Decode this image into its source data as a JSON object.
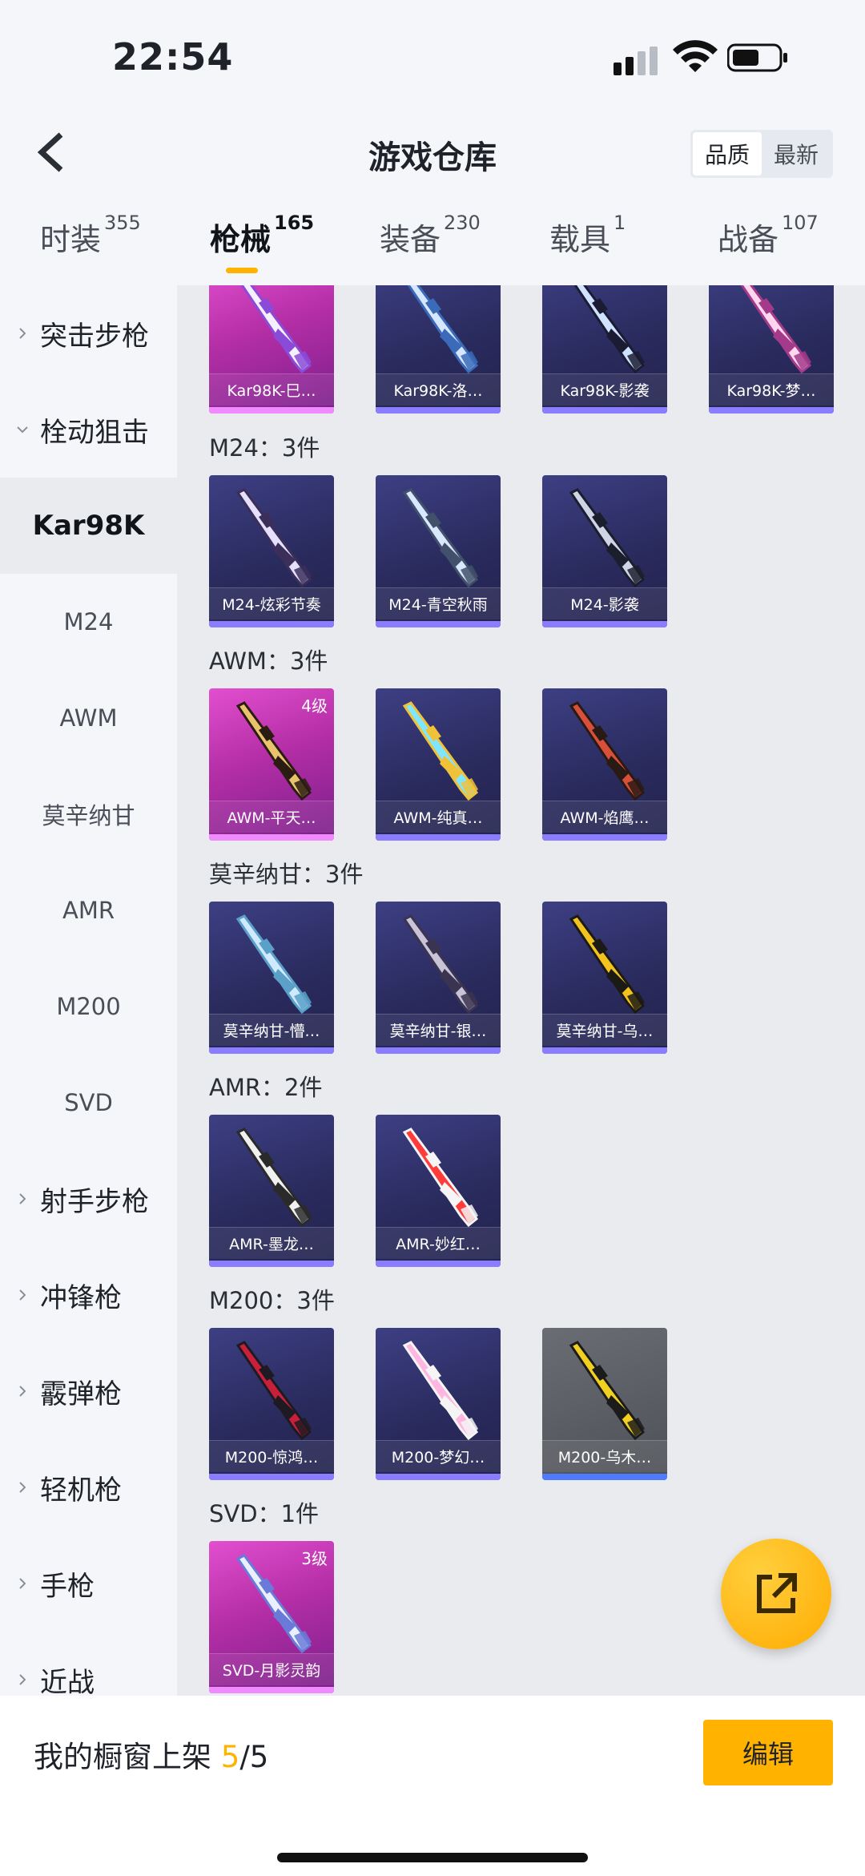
{
  "status_bar": {
    "time": "22:54"
  },
  "header": {
    "title": "游戏仓库",
    "sort_options": [
      "品质",
      "最新"
    ],
    "active_sort": "品质"
  },
  "tabs": [
    {
      "label": "时装",
      "count": "355"
    },
    {
      "label": "枪械",
      "count": "165"
    },
    {
      "label": "装备",
      "count": "230"
    },
    {
      "label": "载具",
      "count": "1"
    },
    {
      "label": "战备",
      "count": "107"
    }
  ],
  "sidebar": {
    "items": [
      {
        "label": "突击步枪"
      },
      {
        "label": "栓动狙击"
      },
      {
        "label": "Kar98K"
      },
      {
        "label": "M24"
      },
      {
        "label": "AWM"
      },
      {
        "label": "莫辛纳甘"
      },
      {
        "label": "AMR"
      },
      {
        "label": "M200"
      },
      {
        "label": "SVD"
      },
      {
        "label": "射手步枪"
      },
      {
        "label": "冲锋枪"
      },
      {
        "label": "霰弹枪"
      },
      {
        "label": "轻机枪"
      },
      {
        "label": "手枪"
      },
      {
        "label": "近战"
      }
    ]
  },
  "sections": [
    {
      "title": "",
      "items": [
        {
          "name": "Kar98K-巳…",
          "tier": "legend"
        },
        {
          "name": "Kar98K-洛…",
          "tier": "epic"
        },
        {
          "name": "Kar98K-影袭",
          "tier": "epic"
        },
        {
          "name": "Kar98K-梦…",
          "tier": "epic"
        }
      ]
    },
    {
      "title": "M24：3件",
      "items": [
        {
          "name": "M24-炫彩节奏",
          "tier": "epic"
        },
        {
          "name": "M24-青空秋雨",
          "tier": "epic"
        },
        {
          "name": "M24-影袭",
          "tier": "epic"
        }
      ]
    },
    {
      "title": "AWM：3件",
      "items": [
        {
          "name": "AWM-平天…",
          "tier": "legend",
          "level": "4级"
        },
        {
          "name": "AWM-纯真…",
          "tier": "epic"
        },
        {
          "name": "AWM-焰鹰…",
          "tier": "epic"
        }
      ]
    },
    {
      "title": "莫辛纳甘：3件",
      "items": [
        {
          "name": "莫辛纳甘-懵…",
          "tier": "epic"
        },
        {
          "name": "莫辛纳甘-银…",
          "tier": "epic"
        },
        {
          "name": "莫辛纳甘-乌…",
          "tier": "epic"
        }
      ]
    },
    {
      "title": "AMR：2件",
      "items": [
        {
          "name": "AMR-墨龙…",
          "tier": "epic"
        },
        {
          "name": "AMR-妙红…",
          "tier": "epic"
        }
      ]
    },
    {
      "title": "M200：3件",
      "items": [
        {
          "name": "M200-惊鸿…",
          "tier": "epic"
        },
        {
          "name": "M200-梦幻…",
          "tier": "epic"
        },
        {
          "name": "M200-乌木…",
          "tier": "gray"
        }
      ]
    },
    {
      "title": "SVD：1件",
      "items": [
        {
          "name": "SVD-月影灵韵",
          "tier": "legend",
          "level": "3级"
        }
      ]
    }
  ],
  "bottom_bar": {
    "shelf_label": "我的橱窗上架",
    "shelf_current": "5",
    "shelf_total": "/5",
    "edit_label": "编辑"
  },
  "colors": {
    "accent": "#ffb300",
    "legend_card": "#c93bb8",
    "epic_card": "#2f3068",
    "gray_card": "#5a5d63"
  },
  "icons": {
    "back": "chevron-left-icon",
    "fab": "share-external-icon"
  }
}
